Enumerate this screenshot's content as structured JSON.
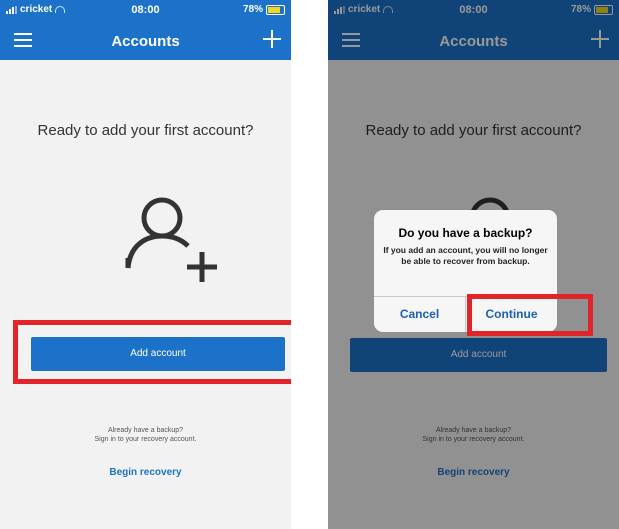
{
  "left_screen": {
    "status": {
      "carrier": "cricket",
      "time": "08:00",
      "battery": "78%"
    },
    "nav": {
      "title": "Accounts"
    },
    "headline": "Ready to add your first account?",
    "add_button_label": "Add account",
    "backup_line1": "Already have a backup?",
    "backup_line2": "Sign in to your recovery account.",
    "recovery_link": "Begin recovery"
  },
  "right_screen": {
    "status": {
      "carrier": "cricket",
      "time": "08:00",
      "battery": "78%"
    },
    "nav": {
      "title": "Accounts"
    },
    "headline": "Ready to add your first account?",
    "add_button_label": "Add account",
    "backup_line1": "Already have a backup?",
    "backup_line2": "Sign in to your recovery account.",
    "recovery_link": "Begin recovery",
    "dialog": {
      "title": "Do you have a backup?",
      "message": "If you add an account, you will no longer be able to recover from backup.",
      "cancel_label": "Cancel",
      "continue_label": "Continue"
    }
  },
  "colors": {
    "nav_blue": "#1b72c8",
    "highlight_red": "#e0242a",
    "link_blue": "#1b72c8"
  },
  "icons": [
    "hamburger-icon",
    "plus-icon",
    "add-person-icon",
    "signal-icon",
    "wifi-icon",
    "battery-icon"
  ]
}
